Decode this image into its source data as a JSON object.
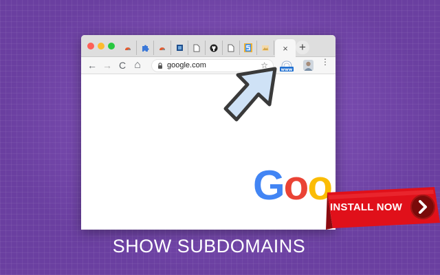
{
  "browser": {
    "tabs": [
      {
        "icon": "cloud-icon"
      },
      {
        "icon": "puzzle-icon"
      },
      {
        "icon": "cloud-icon"
      },
      {
        "icon": "blue-square-icon"
      },
      {
        "icon": "document-icon"
      },
      {
        "icon": "github-icon"
      },
      {
        "icon": "document-icon"
      },
      {
        "icon": "s-logo-icon"
      },
      {
        "icon": "image-icon"
      }
    ],
    "active_tab": {
      "close_label": "×"
    },
    "new_tab_label": "+",
    "toolbar": {
      "back_label": "←",
      "forward_label": "→",
      "reload_label": "C",
      "home_label": "⌂",
      "url": "google.com",
      "star_label": "☆",
      "menu_label": "⋮",
      "extension_label": "www"
    },
    "page": {
      "logo_letters": [
        "G",
        "o",
        "o"
      ],
      "logo_colors": [
        "#4285f4",
        "#ea4335",
        "#fbbc05"
      ]
    }
  },
  "promo": {
    "install_label": "INSTALL NOW",
    "caption": "SHOW SUBDOMAINS"
  },
  "colors": {
    "background": "#6a3fa0",
    "ribbon": "#e0101a",
    "arrow_fill": "#cfe2f6",
    "arrow_stroke": "#3a3a3a"
  }
}
